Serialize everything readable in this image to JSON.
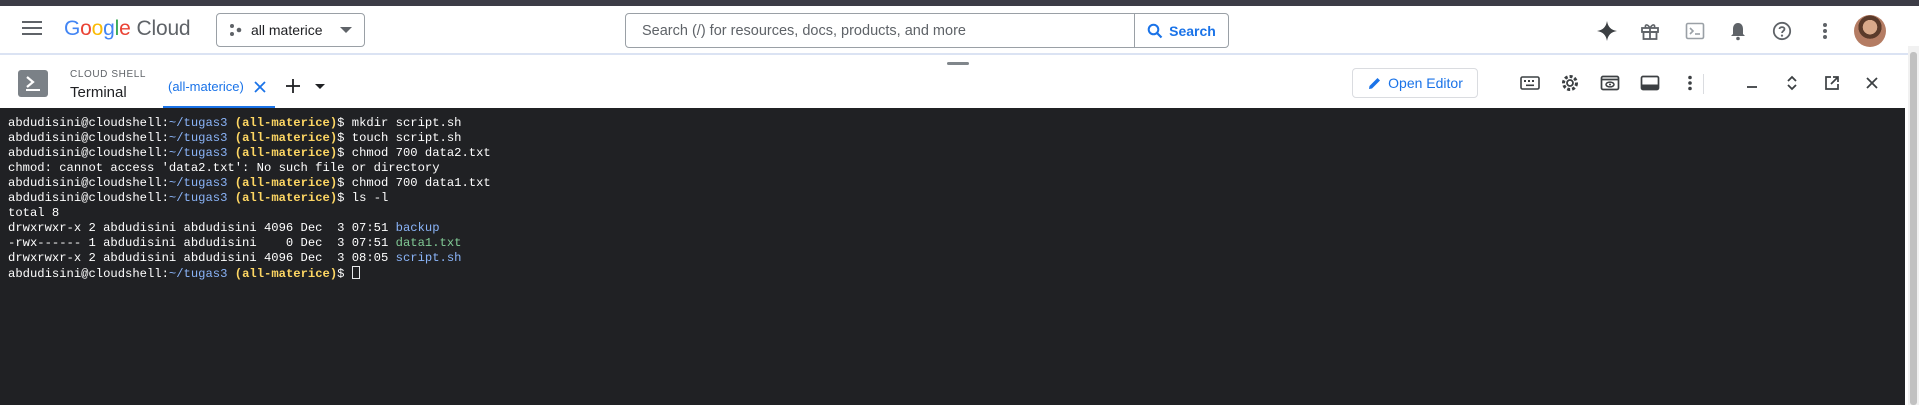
{
  "header": {
    "menu_icon": "hamburger-menu-icon",
    "logo": {
      "google": "Google",
      "cloud": "Cloud"
    },
    "project_picker": {
      "label": "all materice",
      "icon": "project-dots-icon"
    },
    "search": {
      "placeholder": "Search (/) for resources, docs, products, and more",
      "button_label": "Search"
    },
    "icons": [
      "gemini-spark-icon",
      "gift-icon",
      "cloud-shell-icon",
      "notifications-bell-icon",
      "help-icon",
      "more-vert-icon",
      "avatar"
    ]
  },
  "cloud_shell": {
    "title": "CLOUD SHELL",
    "subtitle": "Terminal",
    "tab_label": "(all-materice)",
    "open_editor_label": "Open Editor",
    "toolbar_icons": [
      "keyboard-icon",
      "settings-gear-icon",
      "web-preview-icon",
      "layout-icon",
      "more-vert-icon",
      "minimize-icon",
      "maximize-restore-icon",
      "open-new-window-icon",
      "close-icon"
    ]
  },
  "terminal": {
    "prompt_user": "abdudisini@cloudshell:",
    "prompt_path": "~/tugas3",
    "prompt_project": "(all-materice)",
    "lines": [
      {
        "type": "cmd",
        "text": "$ mkdir script.sh"
      },
      {
        "type": "cmd",
        "text": "$ touch script.sh"
      },
      {
        "type": "cmd",
        "text": "$ chmod 700 data2.txt"
      },
      {
        "type": "out",
        "text": "chmod: cannot access 'data2.txt': No such file or directory"
      },
      {
        "type": "cmd",
        "text": "$ chmod 700 data1.txt"
      },
      {
        "type": "cmd",
        "text": "$ ls -l"
      },
      {
        "type": "out",
        "text": "total 8"
      },
      {
        "type": "ls",
        "prefix": "drwxrwxr-x 2 abdudisini abdudisini 4096 Dec  3 07:51 ",
        "name": "backup",
        "kind": "dir"
      },
      {
        "type": "ls",
        "prefix": "-rwx------ 1 abdudisini abdudisini    0 Dec  3 07:51 ",
        "name": "data1.txt",
        "kind": "exec"
      },
      {
        "type": "ls",
        "prefix": "drwxrwxr-x 2 abdudisini abdudisini 4096 Dec  3 08:05 ",
        "name": "script.sh",
        "kind": "dir"
      },
      {
        "type": "cmd",
        "text": "$ ",
        "cursor": true
      }
    ]
  },
  "colors": {
    "accent": "#1a73e8",
    "terminal_bg": "#202124",
    "path_blue": "#8ab4f8",
    "project_yellow": "#fdd663",
    "exec_green": "#81c995"
  }
}
